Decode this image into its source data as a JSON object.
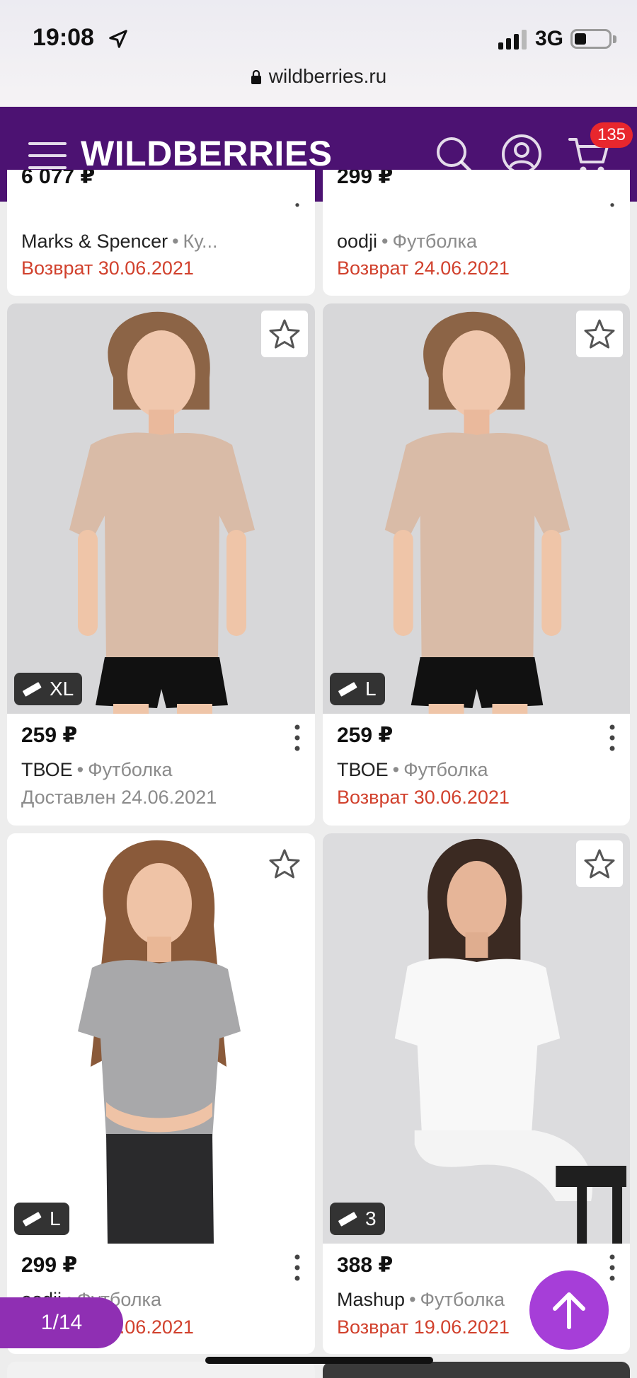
{
  "status_bar": {
    "time": "19:08",
    "network": "3G",
    "url": "wildberries.ru"
  },
  "header": {
    "logo": "WILDBERRIES",
    "cart_count": "135"
  },
  "top_row": [
    {
      "price": "6 077 ₽",
      "brand": "Marks & Spencer",
      "kind": "Ку...",
      "status": "Возврат 30.06.2021",
      "status_type": "return"
    },
    {
      "price": "299 ₽",
      "brand": "oodji",
      "kind": "Футболка",
      "status": "Возврат 24.06.2021",
      "status_type": "return"
    }
  ],
  "products": [
    {
      "price": "259 ₽",
      "brand": "ТВОЕ",
      "kind": "Футболка",
      "status": "Доставлен 24.06.2021",
      "status_type": "delivered",
      "size": "XL",
      "model": "beige"
    },
    {
      "price": "259 ₽",
      "brand": "ТВОЕ",
      "kind": "Футболка",
      "status": "Возврат 30.06.2021",
      "status_type": "return",
      "size": "L",
      "model": "beige"
    },
    {
      "price": "299 ₽",
      "brand": "oodji",
      "kind": "Футболка",
      "status": "Возврат 24.06.2021",
      "status_type": "return",
      "size": "L",
      "model": "gray"
    },
    {
      "price": "388 ₽",
      "brand": "Mashup",
      "kind": "Футболка",
      "status": "Возврат 19.06.2021",
      "status_type": "return",
      "size": "3",
      "model": "white"
    }
  ],
  "pager": {
    "label": "1/14"
  },
  "colors": {
    "brand_purple": "#4c1272",
    "return_red": "#d1412d",
    "badge_red": "#e8272d",
    "accent": "#a63ed8"
  }
}
